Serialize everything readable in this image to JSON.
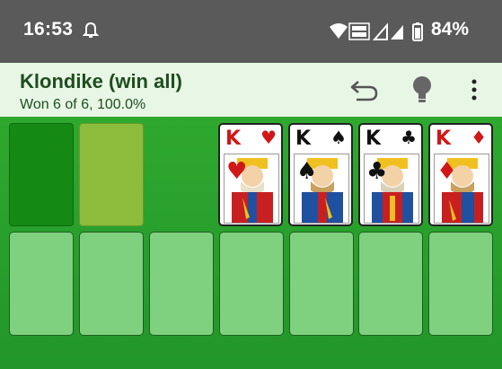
{
  "status": {
    "time": "16:53",
    "battery": "84%"
  },
  "app": {
    "title": "Klondike (win all)",
    "subtitle": "Won 6 of 6, 100.0%"
  },
  "foundations": [
    {
      "rank": "K",
      "suit": "♥",
      "color": "#d01818"
    },
    {
      "rank": "K",
      "suit": "♠",
      "color": "#111111"
    },
    {
      "rank": "K",
      "suit": "♣",
      "color": "#111111"
    },
    {
      "rank": "K",
      "suit": "♦",
      "color": "#d01818"
    }
  ],
  "colors": {
    "table_green": "#2a9a2a",
    "app_bar": "#e8f6e6",
    "status_bar": "#5a5a5a",
    "tableau_slot": "#7fd07f"
  }
}
